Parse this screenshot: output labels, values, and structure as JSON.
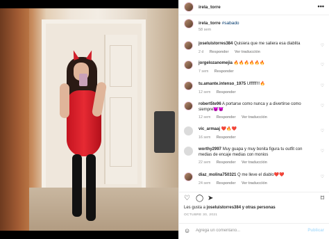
{
  "post": {
    "username": "irela_torre",
    "more_icon": "more-horizontal-icon"
  },
  "caption": {
    "username": "irela_torre",
    "hashtag": "#sabado",
    "time": "58 sem"
  },
  "comments": [
    {
      "user": "joseluistorres384",
      "text": "Quisiera que me saliera esa diablita",
      "time": "2 d",
      "reply": "Responder",
      "translate": "Ver traducción"
    },
    {
      "user": "jorgelozanomejia",
      "text": "🔥🔥🔥🔥🔥🔥",
      "time": "7 sem",
      "reply": "Responder",
      "translate": ""
    },
    {
      "user": "tu.amante.intenso_1975",
      "text": "Uffffff!!!🔥",
      "time": "12 sem",
      "reply": "Responder",
      "translate": ""
    },
    {
      "user": "robert5te96",
      "text": "A portarse como nunca y a divertirse como siempre😈😈",
      "time": "12 sem",
      "reply": "Responder",
      "translate": "Ver traducción"
    },
    {
      "user": "vic_armaaj",
      "text": "❤️🔥❤️",
      "time": "16 sem",
      "reply": "Responder",
      "translate": ""
    },
    {
      "user": "worthy2997",
      "text": "Muy guapa y muy bonita figura tu outfit con medias de encaje medias con monios",
      "time": "22 sem",
      "reply": "Responder",
      "translate": "Ver traducción"
    },
    {
      "user": "diaz_molina750321",
      "text": "Q me lleve el diablo❤️❤️",
      "time": "24 sem",
      "reply": "Responder",
      "translate": "Ver traducción"
    }
  ],
  "actions": {
    "like_icon": "heart-icon",
    "comment_icon": "comment-icon",
    "share_icon": "share-icon",
    "save_icon": "bookmark-icon"
  },
  "likes": {
    "prefix": "Les gusta a",
    "user": "joseluistorres384",
    "suffix": "y otras personas"
  },
  "date": "OCTUBRE 30, 2021",
  "add_comment": {
    "placeholder": "Agrega un comentario...",
    "publish": "Publicar",
    "emoji_icon": "emoji-icon"
  }
}
